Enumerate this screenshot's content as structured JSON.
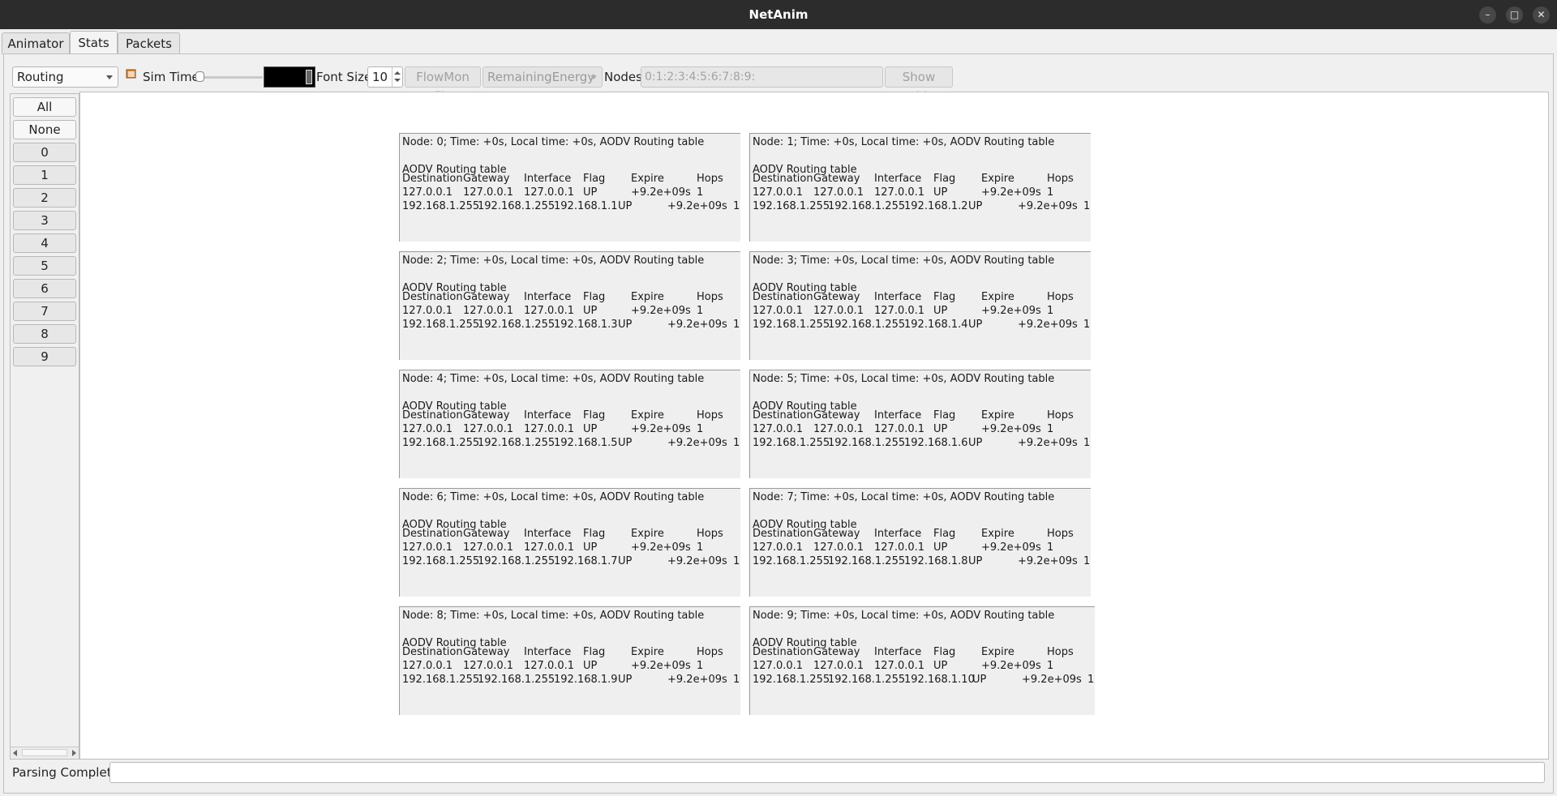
{
  "window": {
    "title": "NetAnim"
  },
  "tabs": [
    {
      "label": "Animator"
    },
    {
      "label": "Stats"
    },
    {
      "label": "Packets"
    }
  ],
  "toolbar": {
    "stat_type": "Routing",
    "sim_time_label": "Sim Time",
    "font_size_label": "Font Size",
    "font_size_value": "10",
    "flowmon_label": "FlowMon file",
    "counter_select": "RemainingEnergy",
    "nodes_label": "Nodes",
    "nodes_placeholder": "0:1:2:3:4:5:6:7:8:9:",
    "show_table_label": "Show Table"
  },
  "node_list": {
    "all_label": "All",
    "none_label": "None",
    "items": [
      "0",
      "1",
      "2",
      "3",
      "4",
      "5",
      "6",
      "7",
      "8",
      "9"
    ]
  },
  "routing_tables": [
    {
      "header": "Node: 0; Time: +0s, Local time: +0s, AODV Routing table",
      "subtitle": "AODV Routing table",
      "columns": [
        "Destination",
        "Gateway",
        "Interface",
        "Flag",
        "Expire",
        "Hops"
      ],
      "rows": [
        [
          "127.0.0.1",
          "127.0.0.1",
          "127.0.0.1",
          "UP",
          "+9.2e+09s",
          "1"
        ],
        [
          "192.168.1.255",
          "192.168.1.255",
          "192.168.1.1",
          "UP",
          "+9.2e+09s",
          "1"
        ]
      ]
    },
    {
      "header": "Node: 1; Time: +0s, Local time: +0s, AODV Routing table",
      "subtitle": "AODV Routing table",
      "columns": [
        "Destination",
        "Gateway",
        "Interface",
        "Flag",
        "Expire",
        "Hops"
      ],
      "rows": [
        [
          "127.0.0.1",
          "127.0.0.1",
          "127.0.0.1",
          "UP",
          "+9.2e+09s",
          "1"
        ],
        [
          "192.168.1.255",
          "192.168.1.255",
          "192.168.1.2",
          "UP",
          "+9.2e+09s",
          "1"
        ]
      ]
    },
    {
      "header": "Node: 2; Time: +0s, Local time: +0s, AODV Routing table",
      "subtitle": "AODV Routing table",
      "columns": [
        "Destination",
        "Gateway",
        "Interface",
        "Flag",
        "Expire",
        "Hops"
      ],
      "rows": [
        [
          "127.0.0.1",
          "127.0.0.1",
          "127.0.0.1",
          "UP",
          "+9.2e+09s",
          "1"
        ],
        [
          "192.168.1.255",
          "192.168.1.255",
          "192.168.1.3",
          "UP",
          "+9.2e+09s",
          "1"
        ]
      ]
    },
    {
      "header": "Node: 3; Time: +0s, Local time: +0s, AODV Routing table",
      "subtitle": "AODV Routing table",
      "columns": [
        "Destination",
        "Gateway",
        "Interface",
        "Flag",
        "Expire",
        "Hops"
      ],
      "rows": [
        [
          "127.0.0.1",
          "127.0.0.1",
          "127.0.0.1",
          "UP",
          "+9.2e+09s",
          "1"
        ],
        [
          "192.168.1.255",
          "192.168.1.255",
          "192.168.1.4",
          "UP",
          "+9.2e+09s",
          "1"
        ]
      ]
    },
    {
      "header": "Node: 4; Time: +0s, Local time: +0s, AODV Routing table",
      "subtitle": "AODV Routing table",
      "columns": [
        "Destination",
        "Gateway",
        "Interface",
        "Flag",
        "Expire",
        "Hops"
      ],
      "rows": [
        [
          "127.0.0.1",
          "127.0.0.1",
          "127.0.0.1",
          "UP",
          "+9.2e+09s",
          "1"
        ],
        [
          "192.168.1.255",
          "192.168.1.255",
          "192.168.1.5",
          "UP",
          "+9.2e+09s",
          "1"
        ]
      ]
    },
    {
      "header": "Node: 5; Time: +0s, Local time: +0s, AODV Routing table",
      "subtitle": "AODV Routing table",
      "columns": [
        "Destination",
        "Gateway",
        "Interface",
        "Flag",
        "Expire",
        "Hops"
      ],
      "rows": [
        [
          "127.0.0.1",
          "127.0.0.1",
          "127.0.0.1",
          "UP",
          "+9.2e+09s",
          "1"
        ],
        [
          "192.168.1.255",
          "192.168.1.255",
          "192.168.1.6",
          "UP",
          "+9.2e+09s",
          "1"
        ]
      ]
    },
    {
      "header": "Node: 6; Time: +0s, Local time: +0s, AODV Routing table",
      "subtitle": "AODV Routing table",
      "columns": [
        "Destination",
        "Gateway",
        "Interface",
        "Flag",
        "Expire",
        "Hops"
      ],
      "rows": [
        [
          "127.0.0.1",
          "127.0.0.1",
          "127.0.0.1",
          "UP",
          "+9.2e+09s",
          "1"
        ],
        [
          "192.168.1.255",
          "192.168.1.255",
          "192.168.1.7",
          "UP",
          "+9.2e+09s",
          "1"
        ]
      ]
    },
    {
      "header": "Node: 7; Time: +0s, Local time: +0s, AODV Routing table",
      "subtitle": "AODV Routing table",
      "columns": [
        "Destination",
        "Gateway",
        "Interface",
        "Flag",
        "Expire",
        "Hops"
      ],
      "rows": [
        [
          "127.0.0.1",
          "127.0.0.1",
          "127.0.0.1",
          "UP",
          "+9.2e+09s",
          "1"
        ],
        [
          "192.168.1.255",
          "192.168.1.255",
          "192.168.1.8",
          "UP",
          "+9.2e+09s",
          "1"
        ]
      ]
    },
    {
      "header": "Node: 8; Time: +0s, Local time: +0s, AODV Routing table",
      "subtitle": "AODV Routing table",
      "columns": [
        "Destination",
        "Gateway",
        "Interface",
        "Flag",
        "Expire",
        "Hops"
      ],
      "rows": [
        [
          "127.0.0.1",
          "127.0.0.1",
          "127.0.0.1",
          "UP",
          "+9.2e+09s",
          "1"
        ],
        [
          "192.168.1.255",
          "192.168.1.255",
          "192.168.1.9",
          "UP",
          "+9.2e+09s",
          "1"
        ]
      ]
    },
    {
      "header": "Node: 9; Time: +0s, Local time: +0s, AODV Routing table",
      "subtitle": "AODV Routing table",
      "columns": [
        "Destination",
        "Gateway",
        "Interface",
        "Flag",
        "Expire",
        "Hops"
      ],
      "rows": [
        [
          "127.0.0.1",
          "127.0.0.1",
          "127.0.0.1",
          "UP",
          "+9.2e+09s",
          "1"
        ],
        [
          "192.168.1.255",
          "192.168.1.255",
          "192.168.1.10",
          "UP",
          "+9.2e+09s",
          "1"
        ]
      ]
    }
  ],
  "status": {
    "label": "Parsing Complete",
    "value": ""
  }
}
